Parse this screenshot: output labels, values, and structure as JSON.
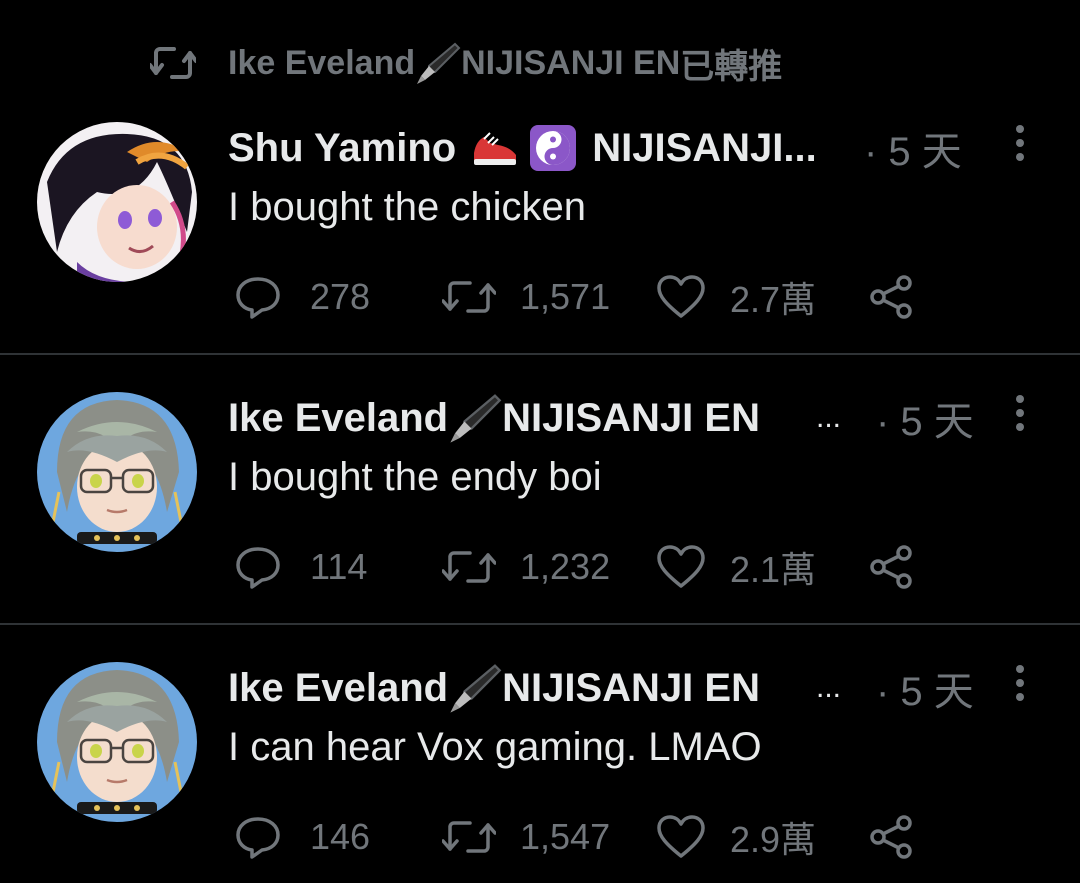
{
  "retweet_header": {
    "user": "Ike Eveland",
    "suffix": "NIJISANJI EN",
    "action": " 已轉推"
  },
  "tweets": [
    {
      "name": "Shu Yamino",
      "handle_tail": "NIJISANJI...",
      "time": "· 5 天",
      "text": "I bought the chicken",
      "replies": "278",
      "retweets": "1,571",
      "likes": "2.7萬"
    },
    {
      "name": "Ike Eveland",
      "handle_tail": "NIJISANJI EN",
      "ellipsis": "...",
      "time": "· 5 天",
      "text": "I bought the endy boi",
      "replies": "114",
      "retweets": "1,232",
      "likes": "2.1萬"
    },
    {
      "name": "Ike Eveland",
      "handle_tail": "NIJISANJI EN",
      "ellipsis": "...",
      "time": "· 5 天",
      "text": "I can hear Vox gaming. LMAO",
      "replies": "146",
      "retweets": "1,547",
      "likes": "2.9萬"
    }
  ],
  "icons": {
    "retweet": "retweet-icon",
    "reply": "reply-icon",
    "like": "heart-icon",
    "share": "share-icon",
    "more": "more-vertical-icon",
    "pen": "fountain-pen-emoji",
    "shoe": "running-shoe-emoji",
    "yinyang": "yin-yang-emoji"
  },
  "colors": {
    "background": "#000000",
    "text_primary": "#e7e9ea",
    "text_secondary": "#71767b",
    "divider": "#2f3336"
  }
}
